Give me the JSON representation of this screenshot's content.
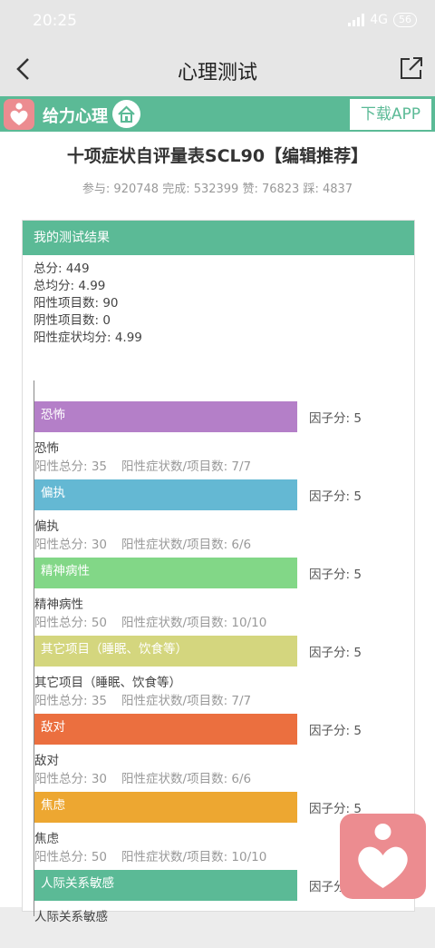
{
  "status": {
    "time": "20:25",
    "network": "4G",
    "battery": "56"
  },
  "nav": {
    "title": "心理测试"
  },
  "brand": {
    "name": "给力心理",
    "download_label": "下载APP"
  },
  "page": {
    "title": "十项症状自评量表SCL90【编辑推荐】",
    "stats": "参与: 920748 完成: 532399 赞: 76823 踩: 4837"
  },
  "result": {
    "header": "我的测试结果",
    "summary": [
      "总分: 449",
      "总均分: 4.99",
      "阳性项目数: 90",
      "阴性项目数: 0",
      "阳性症状均分: 4.99"
    ]
  },
  "factor_items": [
    {
      "label": "恐怖",
      "factor": "因子分: 5",
      "name": "恐怖",
      "positive_total": "阳性总分: 35",
      "ratio": "阳性症状数/项目数: 7/7",
      "color": "#b47fc8"
    },
    {
      "label": "偏执",
      "factor": "因子分: 5",
      "name": "偏执",
      "positive_total": "阳性总分: 30",
      "ratio": "阳性症状数/项目数: 6/6",
      "color": "#64b8d3"
    },
    {
      "label": "精神病性",
      "factor": "因子分: 5",
      "name": "精神病性",
      "positive_total": "阳性总分: 50",
      "ratio": "阳性症状数/项目数: 10/10",
      "color": "#82d787"
    },
    {
      "label": "其它项目（睡眠、饮食等）",
      "factor": "因子分: 5",
      "name": "其它项目（睡眠、饮食等）",
      "positive_total": "阳性总分: 35",
      "ratio": "阳性症状数/项目数: 7/7",
      "color": "#d4d67e"
    },
    {
      "label": "敌对",
      "factor": "因子分: 5",
      "name": "敌对",
      "positive_total": "阳性总分: 30",
      "ratio": "阳性症状数/项目数: 6/6",
      "color": "#eb6f3f"
    },
    {
      "label": "焦虑",
      "factor": "因子分: 5",
      "name": "焦虑",
      "positive_total": "阳性总分: 50",
      "ratio": "阳性症状数/项目数: 10/10",
      "color": "#eda731"
    },
    {
      "label": "人际关系敏感",
      "factor": "因子分",
      "name": "人际关系敏感",
      "positive_total": "",
      "ratio": "",
      "color": "#5bba96"
    }
  ],
  "icons": [
    "back-arrow-icon",
    "share-icon",
    "heart-logo-icon",
    "home-icon",
    "signal-icon"
  ]
}
